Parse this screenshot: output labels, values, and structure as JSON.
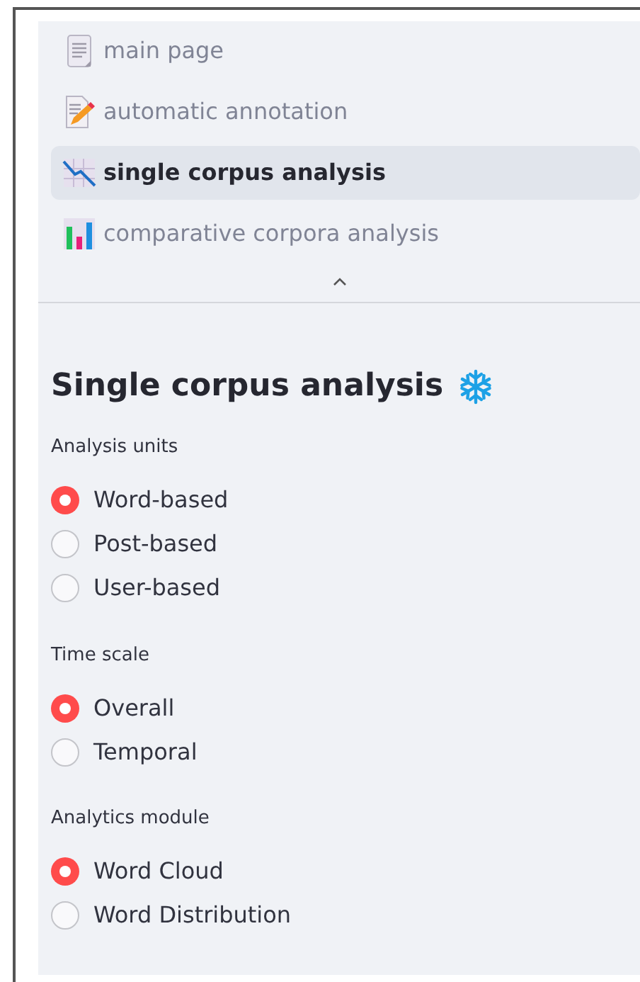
{
  "nav": {
    "items": [
      {
        "label": "main page",
        "selected": false
      },
      {
        "label": "automatic annotation",
        "selected": false
      },
      {
        "label": "single corpus analysis",
        "selected": true
      },
      {
        "label": "comparative corpora analysis",
        "selected": false
      }
    ]
  },
  "heading": "Single corpus analysis",
  "groups": [
    {
      "label": "Analysis units",
      "options": [
        {
          "label": "Word-based",
          "selected": true
        },
        {
          "label": "Post-based",
          "selected": false
        },
        {
          "label": "User-based",
          "selected": false
        }
      ]
    },
    {
      "label": "Time scale",
      "options": [
        {
          "label": "Overall",
          "selected": true
        },
        {
          "label": "Temporal",
          "selected": false
        }
      ]
    },
    {
      "label": "Analytics module",
      "options": [
        {
          "label": "Word Cloud",
          "selected": true
        },
        {
          "label": "Word Distribution",
          "selected": false
        }
      ]
    }
  ]
}
